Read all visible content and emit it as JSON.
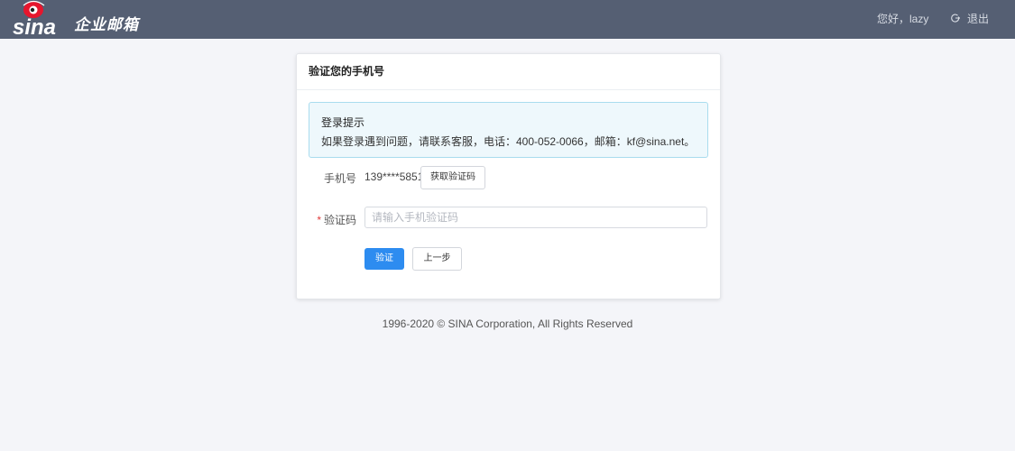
{
  "header": {
    "logo_text": "企业邮箱",
    "greeting": "您好，lazy",
    "logout_label": "退出"
  },
  "card": {
    "title": "验证您的手机号",
    "alert": {
      "title": "登录提示",
      "message": "如果登录遇到问题，请联系客服，电话：400-052-0066，邮箱：kf@sina.net。"
    },
    "phone_label": "手机号",
    "phone_value": "139****5851",
    "get_code_button": "获取验证码",
    "code_label": "验证码",
    "code_required_mark": "*",
    "code_placeholder": "请输入手机验证码",
    "code_value": "",
    "verify_button": "验证",
    "back_button": "上一步"
  },
  "footer": {
    "copyright": "1996-2020 © SINA Corporation, All Rights Reserved"
  },
  "colors": {
    "topbar": "#555f73",
    "primary": "#2d8cf0",
    "alert_bg": "#eef8fc",
    "alert_border": "#a9dcee",
    "required": "#e03a3a"
  },
  "icons": [
    "sina-eye-logo-icon",
    "logout-icon"
  ]
}
